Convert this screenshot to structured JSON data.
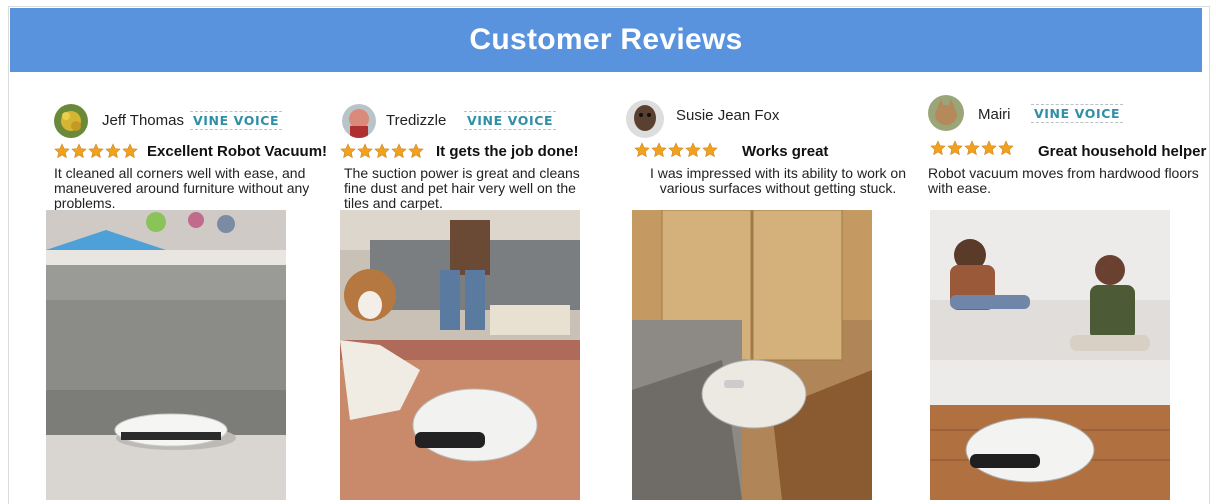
{
  "banner": {
    "title": "Customer Reviews"
  },
  "reviews": [
    {
      "name": "Jeff Thomas",
      "badge": "VINE VOICE",
      "rating": 5,
      "headline": "Excellent Robot Vacuum!",
      "text": "It cleaned all corners well with ease, and maneuvered around furniture without any problems.",
      "photo_icon": "robot-vacuum-under-sofa"
    },
    {
      "name": "Tredizzle",
      "badge": "VINE VOICE",
      "rating": 5,
      "headline": "It gets the job done!",
      "text": "The suction power is great and cleans fine dust and pet hair very well on the tiles and carpet.",
      "photo_icon": "robot-vacuum-with-dog"
    },
    {
      "name": "Susie Jean Fox",
      "badge": "",
      "rating": 5,
      "headline": "Works great",
      "text": "I was impressed with its ability to work on various surfaces without getting stuck.",
      "photo_icon": "robot-vacuum-by-door"
    },
    {
      "name": "Mairi",
      "badge": "VINE VOICE",
      "rating": 5,
      "headline": "Great household helper",
      "text": "Robot vacuum moves from hardwood floors with ease.",
      "photo_icon": "robot-vacuum-family"
    }
  ],
  "colors": {
    "banner": "#5a93dd",
    "star": "#f0a11e",
    "vine": "#2f8fa7"
  }
}
